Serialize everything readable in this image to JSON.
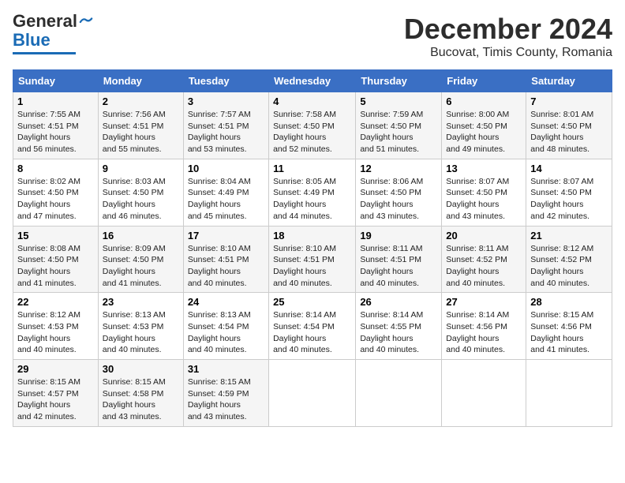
{
  "logo": {
    "line1": "General",
    "line2": "Blue"
  },
  "title": "December 2024",
  "subtitle": "Bucovat, Timis County, Romania",
  "headers": [
    "Sunday",
    "Monday",
    "Tuesday",
    "Wednesday",
    "Thursday",
    "Friday",
    "Saturday"
  ],
  "weeks": [
    [
      {
        "day": "1",
        "sunrise": "7:55 AM",
        "sunset": "4:51 PM",
        "daylight": "8 hours and 56 minutes."
      },
      {
        "day": "2",
        "sunrise": "7:56 AM",
        "sunset": "4:51 PM",
        "daylight": "8 hours and 55 minutes."
      },
      {
        "day": "3",
        "sunrise": "7:57 AM",
        "sunset": "4:51 PM",
        "daylight": "8 hours and 53 minutes."
      },
      {
        "day": "4",
        "sunrise": "7:58 AM",
        "sunset": "4:50 PM",
        "daylight": "8 hours and 52 minutes."
      },
      {
        "day": "5",
        "sunrise": "7:59 AM",
        "sunset": "4:50 PM",
        "daylight": "8 hours and 51 minutes."
      },
      {
        "day": "6",
        "sunrise": "8:00 AM",
        "sunset": "4:50 PM",
        "daylight": "8 hours and 49 minutes."
      },
      {
        "day": "7",
        "sunrise": "8:01 AM",
        "sunset": "4:50 PM",
        "daylight": "8 hours and 48 minutes."
      }
    ],
    [
      {
        "day": "8",
        "sunrise": "8:02 AM",
        "sunset": "4:50 PM",
        "daylight": "8 hours and 47 minutes."
      },
      {
        "day": "9",
        "sunrise": "8:03 AM",
        "sunset": "4:50 PM",
        "daylight": "8 hours and 46 minutes."
      },
      {
        "day": "10",
        "sunrise": "8:04 AM",
        "sunset": "4:49 PM",
        "daylight": "8 hours and 45 minutes."
      },
      {
        "day": "11",
        "sunrise": "8:05 AM",
        "sunset": "4:49 PM",
        "daylight": "8 hours and 44 minutes."
      },
      {
        "day": "12",
        "sunrise": "8:06 AM",
        "sunset": "4:50 PM",
        "daylight": "8 hours and 43 minutes."
      },
      {
        "day": "13",
        "sunrise": "8:07 AM",
        "sunset": "4:50 PM",
        "daylight": "8 hours and 43 minutes."
      },
      {
        "day": "14",
        "sunrise": "8:07 AM",
        "sunset": "4:50 PM",
        "daylight": "8 hours and 42 minutes."
      }
    ],
    [
      {
        "day": "15",
        "sunrise": "8:08 AM",
        "sunset": "4:50 PM",
        "daylight": "8 hours and 41 minutes."
      },
      {
        "day": "16",
        "sunrise": "8:09 AM",
        "sunset": "4:50 PM",
        "daylight": "8 hours and 41 minutes."
      },
      {
        "day": "17",
        "sunrise": "8:10 AM",
        "sunset": "4:51 PM",
        "daylight": "8 hours and 40 minutes."
      },
      {
        "day": "18",
        "sunrise": "8:10 AM",
        "sunset": "4:51 PM",
        "daylight": "8 hours and 40 minutes."
      },
      {
        "day": "19",
        "sunrise": "8:11 AM",
        "sunset": "4:51 PM",
        "daylight": "8 hours and 40 minutes."
      },
      {
        "day": "20",
        "sunrise": "8:11 AM",
        "sunset": "4:52 PM",
        "daylight": "8 hours and 40 minutes."
      },
      {
        "day": "21",
        "sunrise": "8:12 AM",
        "sunset": "4:52 PM",
        "daylight": "8 hours and 40 minutes."
      }
    ],
    [
      {
        "day": "22",
        "sunrise": "8:12 AM",
        "sunset": "4:53 PM",
        "daylight": "8 hours and 40 minutes."
      },
      {
        "day": "23",
        "sunrise": "8:13 AM",
        "sunset": "4:53 PM",
        "daylight": "8 hours and 40 minutes."
      },
      {
        "day": "24",
        "sunrise": "8:13 AM",
        "sunset": "4:54 PM",
        "daylight": "8 hours and 40 minutes."
      },
      {
        "day": "25",
        "sunrise": "8:14 AM",
        "sunset": "4:54 PM",
        "daylight": "8 hours and 40 minutes."
      },
      {
        "day": "26",
        "sunrise": "8:14 AM",
        "sunset": "4:55 PM",
        "daylight": "8 hours and 40 minutes."
      },
      {
        "day": "27",
        "sunrise": "8:14 AM",
        "sunset": "4:56 PM",
        "daylight": "8 hours and 40 minutes."
      },
      {
        "day": "28",
        "sunrise": "8:15 AM",
        "sunset": "4:56 PM",
        "daylight": "8 hours and 41 minutes."
      }
    ],
    [
      {
        "day": "29",
        "sunrise": "8:15 AM",
        "sunset": "4:57 PM",
        "daylight": "8 hours and 42 minutes."
      },
      {
        "day": "30",
        "sunrise": "8:15 AM",
        "sunset": "4:58 PM",
        "daylight": "8 hours and 43 minutes."
      },
      {
        "day": "31",
        "sunrise": "8:15 AM",
        "sunset": "4:59 PM",
        "daylight": "8 hours and 43 minutes."
      },
      null,
      null,
      null,
      null
    ]
  ]
}
